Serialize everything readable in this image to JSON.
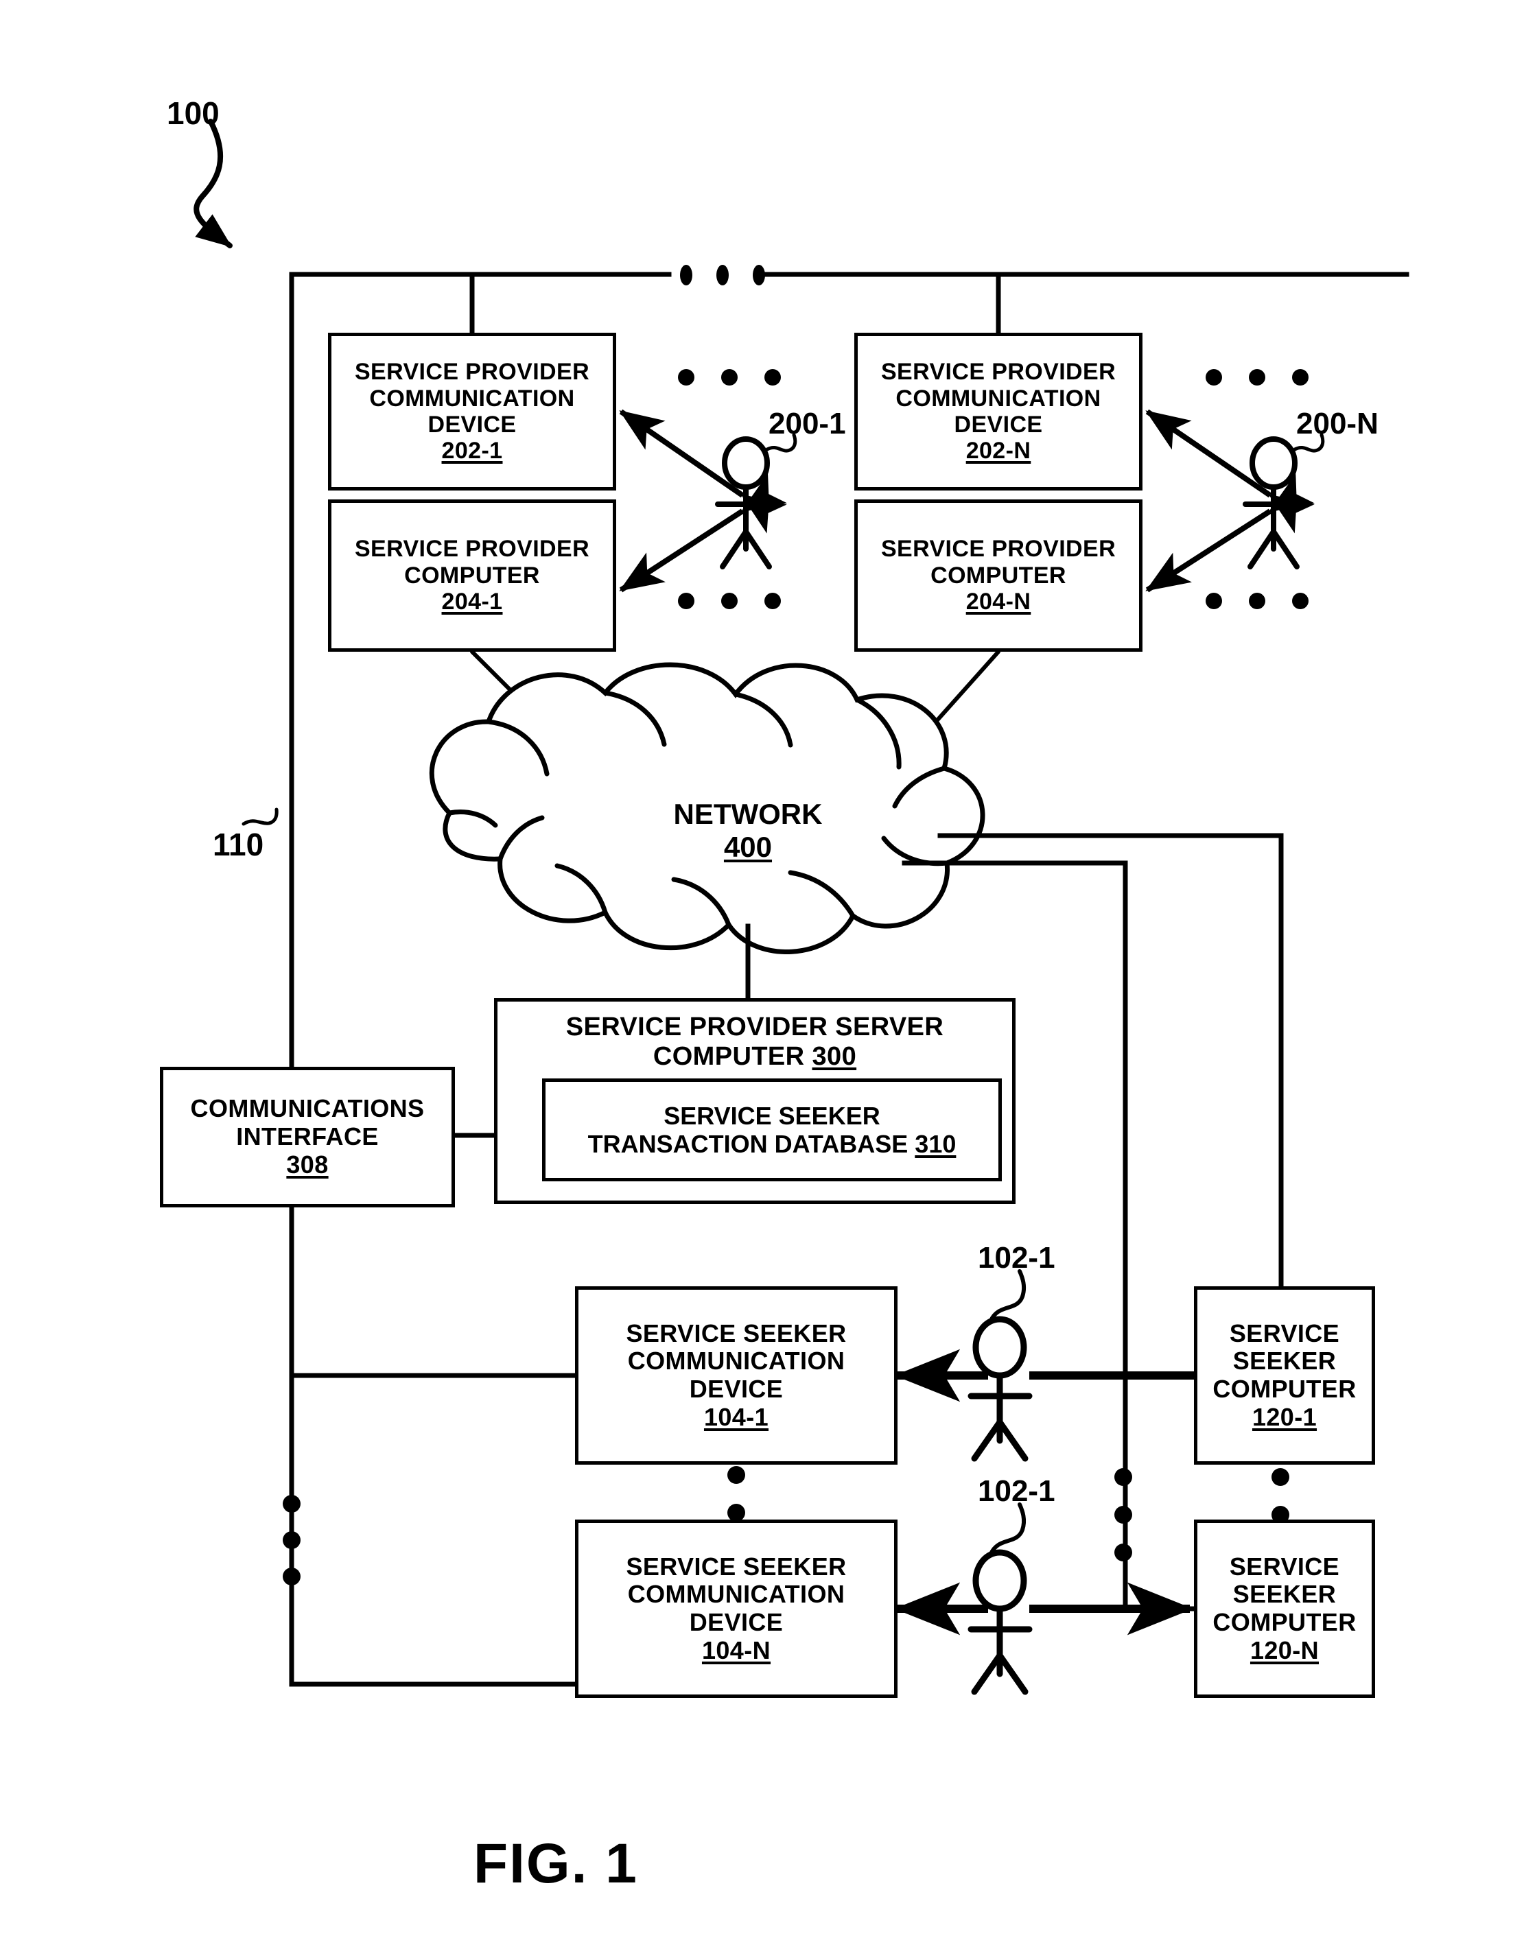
{
  "figure": {
    "label": "FIG. 1",
    "system_ref": "100",
    "network_bus_ref": "110"
  },
  "cloud": {
    "title": "NETWORK",
    "ref": "400"
  },
  "provider_groups": [
    {
      "comm_device": {
        "lines": [
          "SERVICE PROVIDER",
          "COMMUNICATION",
          "DEVICE"
        ],
        "ref": "202-1"
      },
      "computer": {
        "lines": [
          "SERVICE PROVIDER",
          "COMPUTER"
        ],
        "ref": "204-1"
      },
      "actor_ref": "200-1"
    },
    {
      "comm_device": {
        "lines": [
          "SERVICE PROVIDER",
          "COMMUNICATION",
          "DEVICE"
        ],
        "ref": "202-N"
      },
      "computer": {
        "lines": [
          "SERVICE PROVIDER",
          "COMPUTER"
        ],
        "ref": "204-N"
      },
      "actor_ref": "200-N"
    }
  ],
  "server": {
    "lines": [
      "SERVICE PROVIDER SERVER",
      "COMPUTER"
    ],
    "ref": "300",
    "database": {
      "lines": [
        "SERVICE SEEKER",
        "TRANSACTION DATABASE"
      ],
      "ref": "310"
    }
  },
  "comm_interface": {
    "lines": [
      "COMMUNICATIONS",
      "INTERFACE"
    ],
    "ref": "308"
  },
  "seeker_groups": [
    {
      "comm_device": {
        "lines": [
          "SERVICE SEEKER",
          "COMMUNICATION",
          "DEVICE"
        ],
        "ref": "104-1"
      },
      "computer": {
        "lines": [
          "SERVICE",
          "SEEKER",
          "COMPUTER"
        ],
        "ref": "120-1"
      },
      "actor_ref": "102-1"
    },
    {
      "comm_device": {
        "lines": [
          "SERVICE SEEKER",
          "COMMUNICATION",
          "DEVICE"
        ],
        "ref": "104-N"
      },
      "computer": {
        "lines": [
          "SERVICE",
          "SEEKER",
          "COMPUTER"
        ],
        "ref": "120-N"
      },
      "actor_ref": "102-1"
    }
  ],
  "colors": {
    "ink": "#000000",
    "paper": "#ffffff"
  }
}
